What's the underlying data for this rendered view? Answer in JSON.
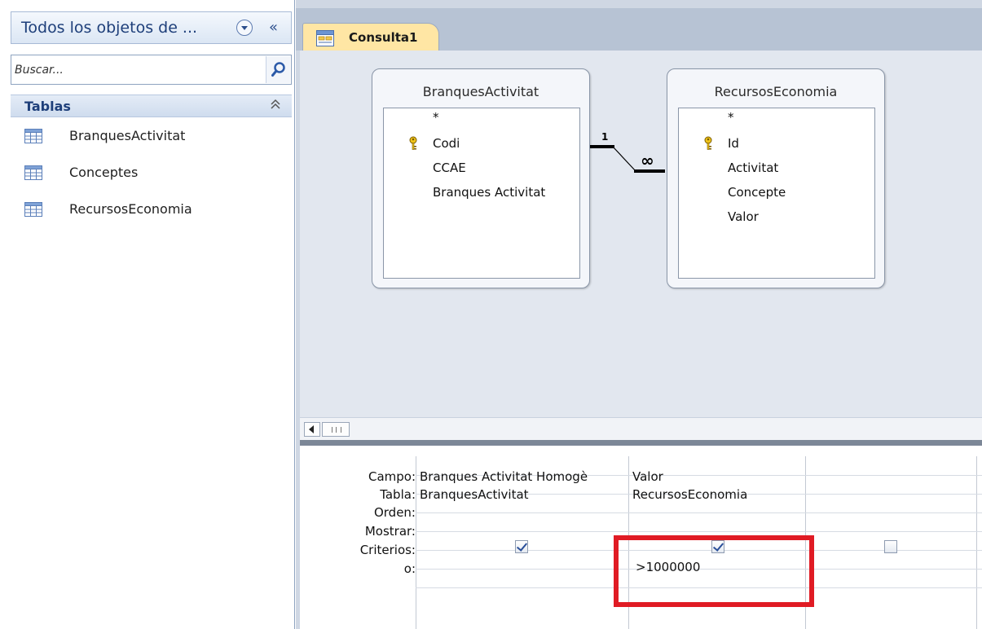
{
  "nav_pane": {
    "title": "Todos los objetos de ...",
    "collapse_glyph": "«",
    "search": {
      "placeholder": "Buscar...",
      "value": ""
    },
    "group": {
      "label": "Tablas",
      "collapse_glyph": "⌃"
    },
    "items": [
      {
        "label": "BranquesActivitat",
        "icon": "table-icon"
      },
      {
        "label": "Conceptes",
        "icon": "table-icon"
      },
      {
        "label": "RecursosEconomia",
        "icon": "table-icon"
      }
    ]
  },
  "document_tab": {
    "label": "Consulta1",
    "icon": "query-icon"
  },
  "design_view": {
    "tables": [
      {
        "name": "BranquesActivitat",
        "fields": [
          "*",
          "Codi",
          "CCAE",
          "Branques Activitat"
        ],
        "primary_key": "Codi"
      },
      {
        "name": "RecursosEconomia",
        "fields": [
          "*",
          "Id",
          "Activitat",
          "Concepte",
          "Valor"
        ],
        "primary_key": "Id"
      }
    ],
    "relationship": {
      "one_side": "1",
      "many_side": "∞"
    }
  },
  "query_grid": {
    "row_labels": [
      "Campo:",
      "Tabla:",
      "Orden:",
      "Mostrar:",
      "Criterios:",
      "o:"
    ],
    "columns": [
      {
        "campo": "Branques Activitat Homogè",
        "tabla": "BranquesActivitat",
        "orden": "",
        "mostrar": true,
        "criterios": "",
        "o": ""
      },
      {
        "campo": "Valor",
        "tabla": "RecursosEconomia",
        "orden": "",
        "mostrar": true,
        "criterios": ">1000000",
        "o": ""
      },
      {
        "campo": "",
        "tabla": "",
        "orden": "",
        "mostrar": false,
        "criterios": "",
        "o": ""
      }
    ]
  },
  "colors": {
    "highlight": "#e01b24",
    "tab_active": "#ffe6a4",
    "nav_title": "#1e3f7a"
  }
}
